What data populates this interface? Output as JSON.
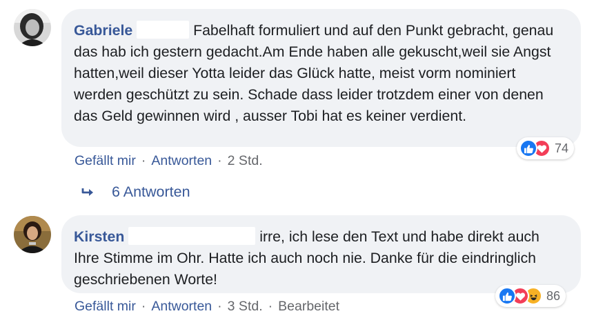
{
  "comments": [
    {
      "author": "Gabriele",
      "text_first": "Fabelhaft formuliert und auf den Punkt",
      "text_rest": "gebracht, genau das hab ich gestern gedacht.Am Ende haben alle gekuscht,weil sie Angst hatten,weil dieser Yotta leider das Glück hatte, meist vorm nominiert werden geschützt zu sein. Schade dass leider trotzdem einer von denen das Geld gewinnen wird , ausser Tobi hat es keiner verdient.",
      "reaction_count": "74",
      "reactions": [
        "like-icon",
        "love-icon"
      ],
      "like_label": "Gefällt mir",
      "reply_label": "Antworten",
      "time": "2 Std.",
      "replies_label": "6 Antworten"
    },
    {
      "author": "Kirsten",
      "text_first": "irre, ich lese den Text und habe direkt",
      "text_rest": "auch Ihre Stimme im Ohr. Hatte ich auch noch nie. Danke für die eindringlich geschriebenen Worte!",
      "reaction_count": "86",
      "reactions": [
        "like-icon",
        "love-icon",
        "haha-icon"
      ],
      "like_label": "Gefällt mir",
      "reply_label": "Antworten",
      "time": "3 Std.",
      "edited": "Bearbeitet"
    }
  ],
  "colors": {
    "link": "#385898",
    "meta": "#65676b",
    "bubble": "#f0f2f5",
    "like": "#1877f2",
    "love": "#f33e58",
    "haha": "#f7b125"
  }
}
